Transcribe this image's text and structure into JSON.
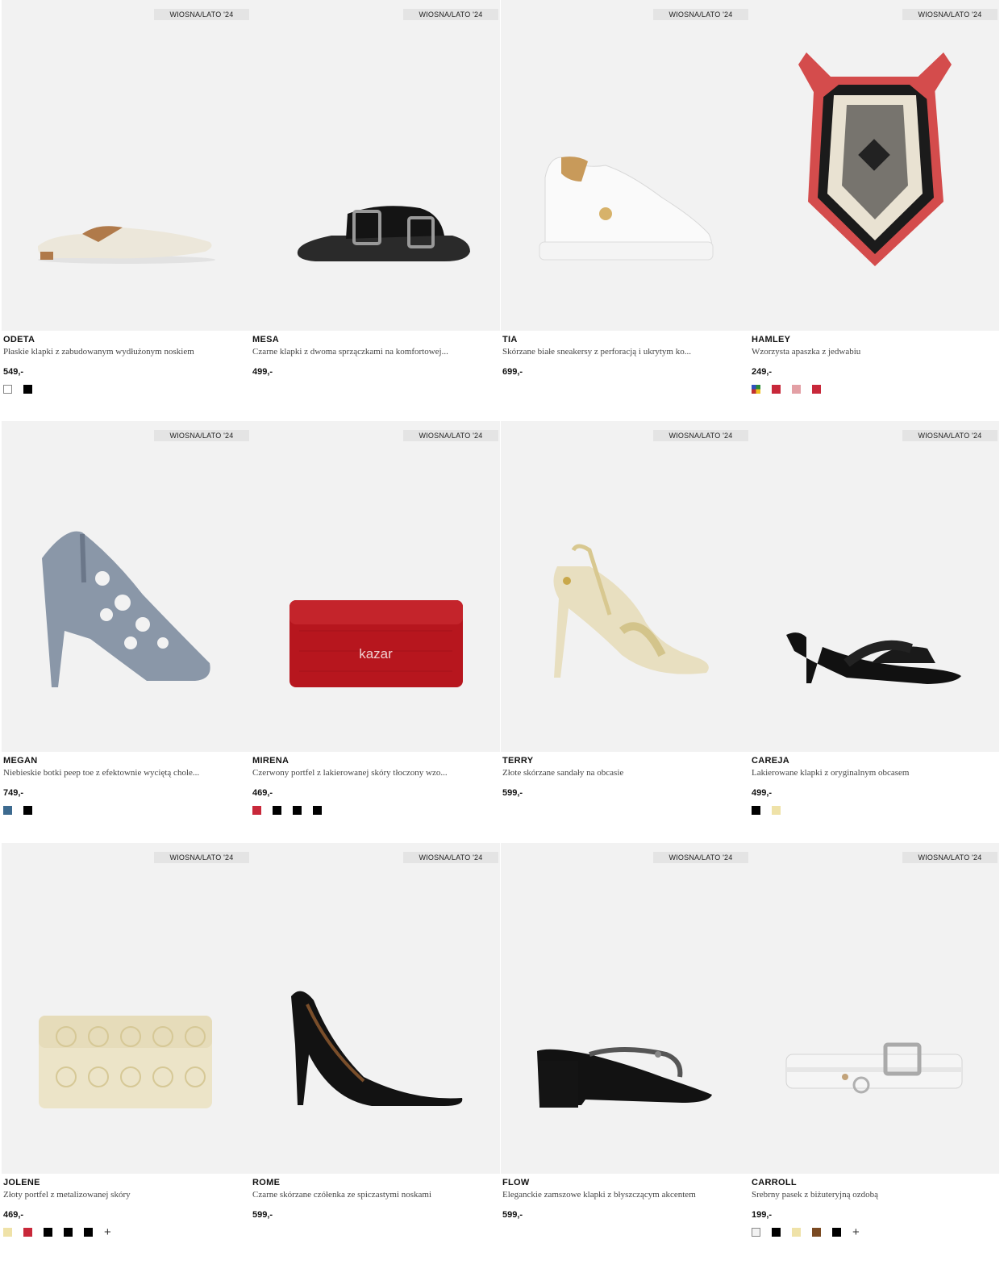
{
  "products": [
    {
      "name": "ODETA",
      "desc": "Płaskie klapki z zabudowanym wydłużonym noskiem",
      "price": "549,-",
      "badge": "WIOSNA/LATO '24",
      "swatches": [
        "#ffffff",
        "#000000"
      ],
      "more": ""
    },
    {
      "name": "MESA",
      "desc": "Czarne klapki z dwoma sprzączkami na komfortowej...",
      "price": "499,-",
      "badge": "WIOSNA/LATO '24",
      "swatches": [],
      "more": ""
    },
    {
      "name": "TIA",
      "desc": "Skórzane białe sneakersy z perforacją i ukrytym ko...",
      "price": "699,-",
      "badge": "WIOSNA/LATO '24",
      "swatches": [],
      "more": ""
    },
    {
      "name": "HAMLEY",
      "desc": "Wzorzysta apaszka z jedwabiu",
      "price": "249,-",
      "badge": "WIOSNA/LATO '24",
      "swatches": [
        "multi",
        "#c8283a",
        "#e3a0a5",
        "#c8283a"
      ],
      "more": ""
    },
    {
      "name": "MEGAN",
      "desc": "Niebieskie botki peep toe z efektownie wyciętą chole...",
      "price": "749,-",
      "badge": "WIOSNA/LATO '24",
      "swatches": [
        "#3d6a8f",
        "#000000"
      ],
      "more": ""
    },
    {
      "name": "MIRENA",
      "desc": "Czerwony portfel z lakierowanej skóry tłoczony wzo...",
      "price": "469,-",
      "badge": "WIOSNA/LATO '24",
      "swatches": [
        "#c8283a",
        "#000000",
        "#000000",
        "#000000"
      ],
      "more": ""
    },
    {
      "name": "TERRY",
      "desc": "Złote skórzane sandały na obcasie",
      "price": "599,-",
      "badge": "WIOSNA/LATO '24",
      "swatches": [],
      "more": ""
    },
    {
      "name": "CAREJA",
      "desc": "Lakierowane klapki z oryginalnym obcasem",
      "price": "499,-",
      "badge": "WIOSNA/LATO '24",
      "swatches": [
        "#000000",
        "#efe2a8"
      ],
      "more": ""
    },
    {
      "name": "JOLENE",
      "desc": "Złoty portfel z metalizowanej skóry",
      "price": "469,-",
      "badge": "WIOSNA/LATO '24",
      "swatches": [
        "#efe2a8",
        "#c8283a",
        "#000000",
        "#000000",
        "#000000"
      ],
      "more": "+"
    },
    {
      "name": "ROME",
      "desc": "Czarne skórzane czółenka ze spiczastymi noskami",
      "price": "599,-",
      "badge": "WIOSNA/LATO '24",
      "swatches": [],
      "more": ""
    },
    {
      "name": "FLOW",
      "desc": "Eleganckie zamszowe klapki z błyszczącym akcentem",
      "price": "599,-",
      "badge": "WIOSNA/LATO '24",
      "swatches": [],
      "more": ""
    },
    {
      "name": "CARROLL",
      "desc": "Srebrny pasek z biżuteryjną ozdobą",
      "price": "199,-",
      "badge": "WIOSNA/LATO '24",
      "swatches": [
        "#f2f2f2",
        "#000000",
        "#efe2a8",
        "#7a4a22",
        "#000000"
      ],
      "more": "+"
    }
  ],
  "product_images": [
    "flat-mule-cream",
    "black-double-buckle-slide",
    "white-sneaker",
    "silk-scarf",
    "blue-cutout-bootie",
    "red-croc-wallet",
    "gold-strappy-sandal",
    "black-heel-mule",
    "gold-wallet",
    "black-pump",
    "black-block-mule",
    "silver-belt"
  ],
  "wallet_logo": "kazar"
}
